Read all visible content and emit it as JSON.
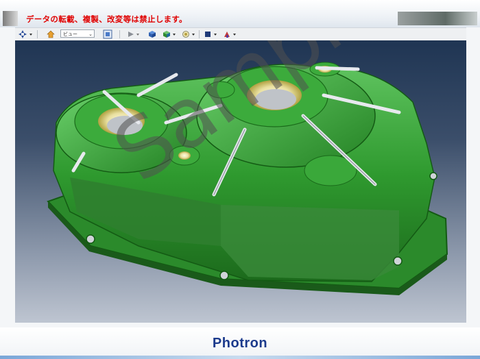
{
  "header": {
    "notice": "データの転載、複製、改変等は禁止します。"
  },
  "toolbar": {
    "view_select_value": "ビュー",
    "icons": [
      "navigate-icon",
      "home-icon",
      "fit-view-icon",
      "play-icon",
      "cube-icon",
      "shaded-cube-icon",
      "light-icon",
      "color-icon",
      "paint-icon"
    ]
  },
  "viewport": {
    "watermark": "Sample"
  },
  "footer": {
    "brand": "Photron"
  },
  "colors": {
    "notice": "#e00000",
    "model_green": "#2f9a2f",
    "brand_blue": "#1b3a8c"
  }
}
